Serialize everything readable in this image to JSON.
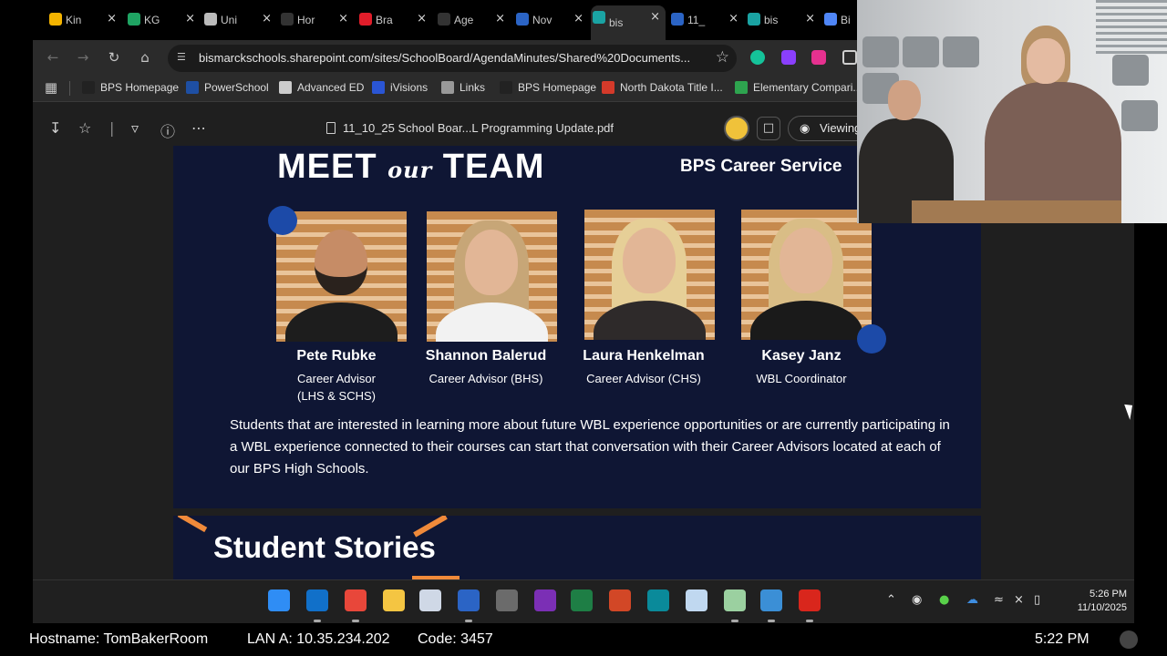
{
  "browser": {
    "tabs": [
      {
        "label": "Kin",
        "icon": "slides-icon",
        "color": "#f4b400"
      },
      {
        "label": "KG",
        "icon": "drive-icon",
        "color": "#1fa463"
      },
      {
        "label": "Uni",
        "icon": "openai-icon",
        "color": "#bbbbbb"
      },
      {
        "label": "Hor",
        "icon": "site-icon",
        "color": "#333333"
      },
      {
        "label": "Bra",
        "icon": "reader-icon",
        "color": "#e11d2a"
      },
      {
        "label": "Age",
        "icon": "site-icon",
        "color": "#333333"
      },
      {
        "label": "Nov",
        "icon": "word-icon",
        "color": "#2b64c5"
      },
      {
        "label": "bis",
        "icon": "sharepoint-icon",
        "color": "#1aa3a3",
        "active": true
      },
      {
        "label": "11_",
        "icon": "word-icon",
        "color": "#2b64c5"
      },
      {
        "label": "bis",
        "icon": "sharepoint-icon",
        "color": "#1aa3a3"
      },
      {
        "label": "Bi",
        "icon": "loading-icon",
        "color": "#4f86f7"
      }
    ],
    "close_glyph": "×",
    "url": "bismarckschools.sharepoint.com/sites/SchoolBoard/AgendaMinutes/Shared%20Documents...",
    "bookmarks": [
      {
        "label": "BPS Homepage",
        "color": "#222222"
      },
      {
        "label": "PowerSchool",
        "color": "#1e4fa3",
        "text": "SIS"
      },
      {
        "label": "Advanced ED",
        "color": "#cccccc"
      },
      {
        "label": "iVisions",
        "color": "#2a55d4"
      },
      {
        "label": "Links",
        "color": "#999999"
      },
      {
        "label": "BPS Homepage",
        "color": "#222222"
      },
      {
        "label": "North Dakota Title I...",
        "color": "#d43a2a"
      },
      {
        "label": "Elementary Compari...",
        "color": "#2ea44f"
      }
    ]
  },
  "pdf": {
    "title": "11_10_25 School Boar...L Programming Update.pdf",
    "viewing_label": "Viewing"
  },
  "slide1": {
    "title_left": "MEET",
    "title_our": "our",
    "title_right": "TEAM",
    "section": "BPS Career Service",
    "members": [
      {
        "name": "Pete Rubke",
        "role": "Career Advisor",
        "role2": "(LHS & SCHS)",
        "hair": "#2a221d",
        "shirt": "#1d1d1d",
        "bald": true
      },
      {
        "name": "Shannon Balerud",
        "role": "Career Advisor (BHS)",
        "role2": "",
        "hair": "#c7a677",
        "shirt": "#f2f2f2"
      },
      {
        "name": "Laura Henkelman",
        "role": "Career Advisor (CHS)",
        "role2": "",
        "hair": "#e6cf97",
        "shirt": "#2e2a2a"
      },
      {
        "name": "Kasey Janz",
        "role": "WBL Coordinator",
        "role2": "",
        "hair": "#d9bd86",
        "shirt": "#1a1a1a"
      }
    ],
    "description": "Students that are interested in learning more about future WBL experience opportunities or are currently participating in a WBL experience connected to their courses can start that conversation with their Career Advisors located at each of our BPS High Schools."
  },
  "slide2": {
    "title": "Student Stories"
  },
  "taskbar": {
    "apps": [
      {
        "name": "start",
        "color": "#2f8df5"
      },
      {
        "name": "outlook",
        "color": "#1170c9"
      },
      {
        "name": "chrome",
        "color": "#e8473a"
      },
      {
        "name": "file-explorer",
        "color": "#f4c542"
      },
      {
        "name": "snipping-tool",
        "color": "#cfd8e6"
      },
      {
        "name": "word",
        "color": "#2b64c5"
      },
      {
        "name": "calculator",
        "color": "#6b6b6b"
      },
      {
        "name": "onenote",
        "color": "#7b2fb5"
      },
      {
        "name": "excel",
        "color": "#1e7e45"
      },
      {
        "name": "powerpoint",
        "color": "#d24726"
      },
      {
        "name": "sway",
        "color": "#0a8a9a"
      },
      {
        "name": "remote-desktop",
        "color": "#c0d8f0"
      },
      {
        "name": "notepad",
        "color": "#9bd0a0"
      },
      {
        "name": "photos",
        "color": "#3b8fd6"
      },
      {
        "name": "acrobat",
        "color": "#d9261c"
      }
    ],
    "time": "5:26 PM",
    "date": "11/10/2025"
  },
  "info": {
    "hostname": "Hostname: TomBakerRoom",
    "lan": "LAN A: 10.35.234.202",
    "code": "Code: 3457",
    "time": "5:22 PM"
  }
}
